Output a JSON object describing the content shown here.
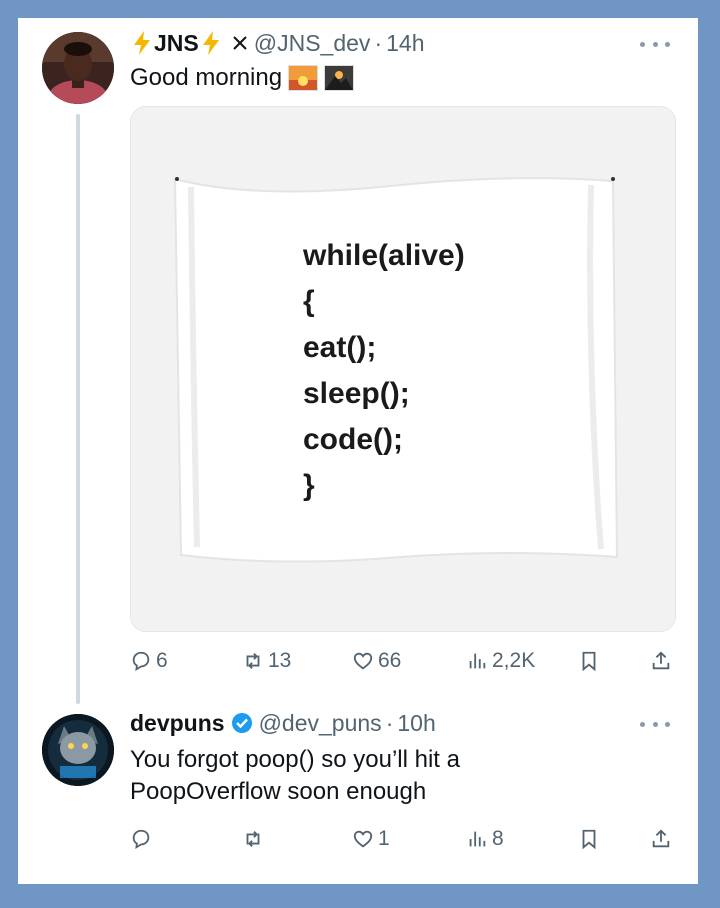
{
  "tweet": {
    "display_name": "JNS",
    "handle": "@JNS_dev",
    "separator": "·",
    "time": "14h",
    "text": "Good morning",
    "image_code_lines": [
      "while(alive)",
      "{",
      "eat();",
      "sleep();",
      "code();",
      "}"
    ],
    "actions": {
      "replies": "6",
      "reposts": "13",
      "likes": "66",
      "views": "2,2K"
    }
  },
  "reply": {
    "display_name": "devpuns",
    "handle": "@dev_puns",
    "separator": "·",
    "time": "10h",
    "text": "You forgot poop() so you’ll hit a PoopOverflow soon enough",
    "actions": {
      "replies": "",
      "reposts": "",
      "likes": "1",
      "views": "8"
    }
  },
  "colors": {
    "border_frame": "#7096c6",
    "muted_text": "#536471",
    "verified_blue": "#1d9bf0",
    "bolt_yellow": "#f5b800"
  },
  "icons": [
    "lightning-icon",
    "x-logo-icon",
    "verified-badge-icon",
    "more-icon",
    "reply-icon",
    "repost-icon",
    "like-icon",
    "views-icon",
    "bookmark-icon",
    "share-icon",
    "sunrise-emoji",
    "mountain-sunrise-emoji"
  ]
}
